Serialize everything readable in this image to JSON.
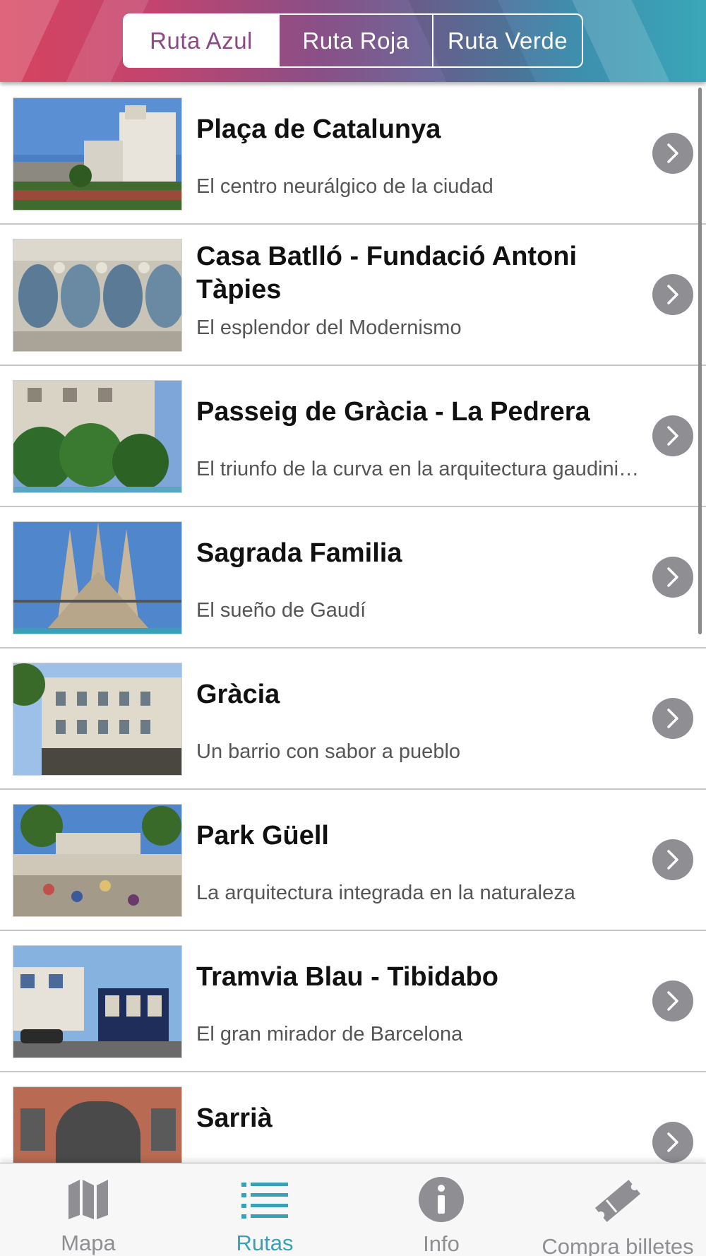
{
  "header": {
    "segments": [
      {
        "label": "Ruta Azul",
        "active": true
      },
      {
        "label": "Ruta Roja",
        "active": false
      },
      {
        "label": "Ruta Verde",
        "active": false
      }
    ],
    "active_color": "#8c4a84"
  },
  "list": {
    "items": [
      {
        "title": "Plaça de Catalunya",
        "subtitle": "El centro neurálgico de la ciudad"
      },
      {
        "title": "Casa Batlló - Fundació Antoni Tàpies",
        "subtitle": "El esplendor del Modernismo"
      },
      {
        "title": "Passeig de Gràcia - La Pedrera",
        "subtitle": "El triunfo de la curva en la arquitectura gaudiniana"
      },
      {
        "title": "Sagrada Familia",
        "subtitle": "El sueño de Gaudí"
      },
      {
        "title": "Gràcia",
        "subtitle": "Un barrio con sabor a pueblo"
      },
      {
        "title": "Park Güell",
        "subtitle": "La arquitectura integrada en la naturaleza"
      },
      {
        "title": "Tramvia Blau - Tibidabo",
        "subtitle": "El gran mirador de Barcelona"
      },
      {
        "title": "Sarrià",
        "subtitle": ""
      }
    ]
  },
  "tabbar": {
    "tabs": [
      {
        "label": "Mapa",
        "icon": "map-icon",
        "active": false
      },
      {
        "label": "Rutas",
        "icon": "list-icon",
        "active": true
      },
      {
        "label": "Info",
        "icon": "info-icon",
        "active": false
      },
      {
        "label": "Compra billetes",
        "icon": "ticket-icon",
        "active": false
      }
    ],
    "active_color": "#3aa0b8",
    "inactive_color": "#8e8e93"
  }
}
